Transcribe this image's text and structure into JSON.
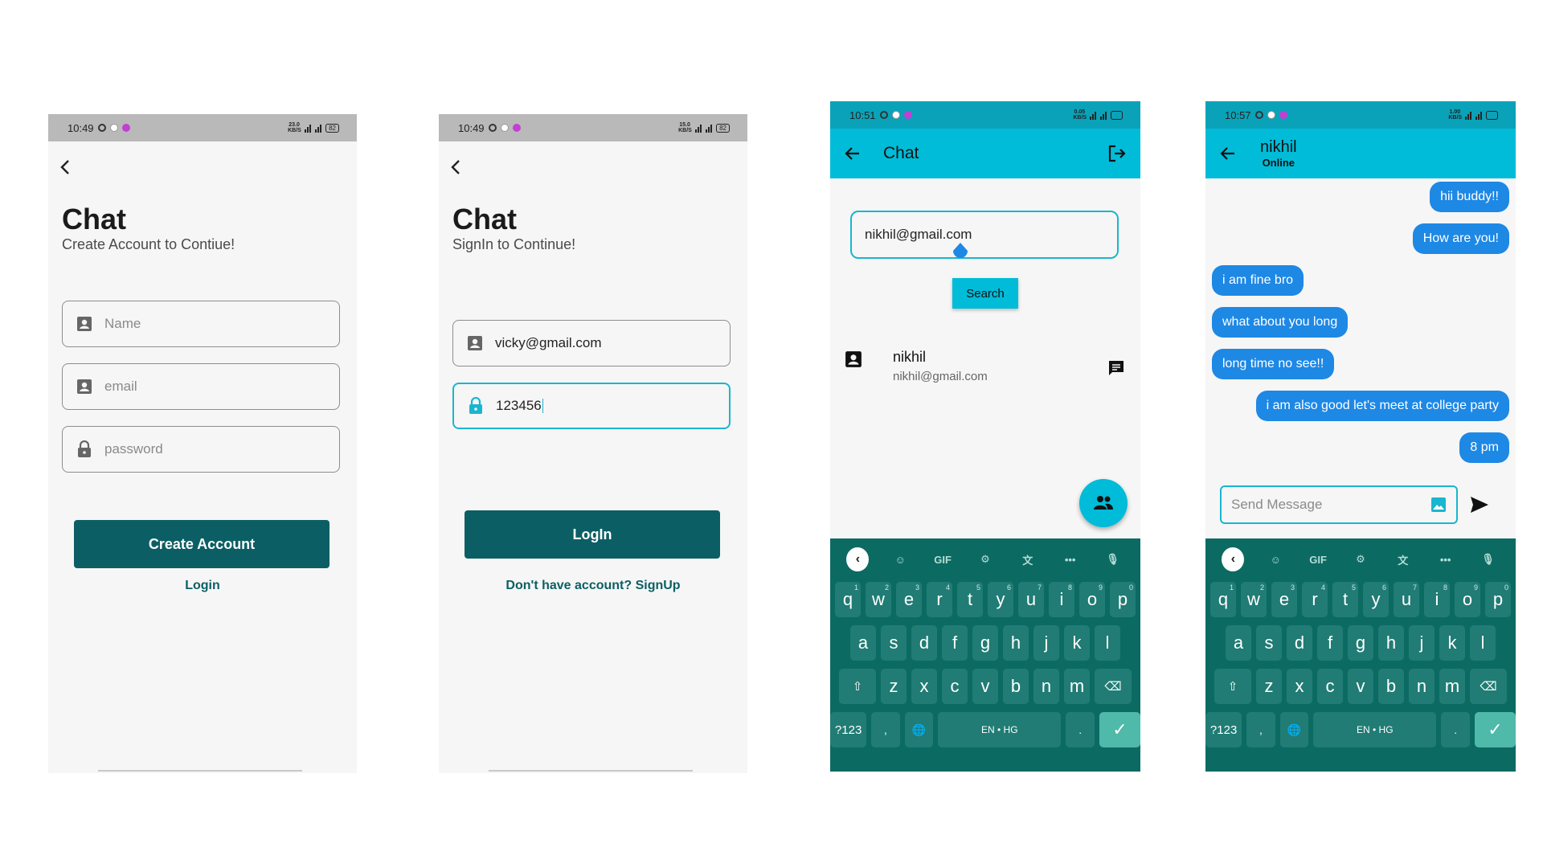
{
  "screen1": {
    "status_time": "10:49",
    "status_net": "23.0 KB/S",
    "status_battery": "82",
    "title": "Chat",
    "subtitle": "Create Account to Contiue!",
    "name_placeholder": "Name",
    "email_placeholder": "email",
    "password_placeholder": "password",
    "create_button": "Create Account",
    "login_link": "Login"
  },
  "screen2": {
    "status_time": "10:49",
    "status_net": "15.0 KB/S",
    "status_battery": "82",
    "title": "Chat",
    "subtitle": "SignIn to Continue!",
    "email_value": "vicky@gmail.com",
    "password_value": "123456",
    "login_button": "LogIn",
    "signup_link": "Don't have account? SignUp"
  },
  "screen3": {
    "status_time": "10:51",
    "status_net": "0.05 KB/S",
    "appbar_title": "Chat",
    "search_value": "nikhil@gmail.com",
    "search_button": "Search",
    "result_name": "nikhil",
    "result_email": "nikhil@gmail.com"
  },
  "screen4": {
    "status_time": "10:57",
    "status_net": "1.00 KB/S",
    "contact_name": "nikhil",
    "contact_status": "Online",
    "messages": [
      {
        "text": "hii buddy!!",
        "side": "right"
      },
      {
        "text": "How are you!",
        "side": "right"
      },
      {
        "text": "i am fine bro",
        "side": "left"
      },
      {
        "text": "what about you long",
        "side": "left"
      },
      {
        "text": "long time no see!!",
        "side": "left"
      },
      {
        "text": "i am also good let's meet at college party",
        "side": "right"
      },
      {
        "text": "8 pm",
        "side": "right"
      }
    ],
    "message_placeholder": "Send Message"
  },
  "keyboard": {
    "gif_label": "GIF",
    "row1": [
      "q",
      "w",
      "e",
      "r",
      "t",
      "y",
      "u",
      "i",
      "o",
      "p"
    ],
    "row1_hints": [
      "1",
      "2",
      "3",
      "4",
      "5",
      "6",
      "7",
      "8",
      "9",
      "0"
    ],
    "row2": [
      "a",
      "s",
      "d",
      "f",
      "g",
      "h",
      "j",
      "k",
      "l"
    ],
    "row3": [
      "z",
      "x",
      "c",
      "v",
      "b",
      "n",
      "m"
    ],
    "symbols_key": "?123",
    "comma_key": ",",
    "period_key": ".",
    "language_label": "EN • HG"
  },
  "colors": {
    "accent": "#00bcd8",
    "primary_dark": "#0b5f64",
    "bubble": "#1e88e5",
    "keyboard_bg": "#0b6b63"
  }
}
